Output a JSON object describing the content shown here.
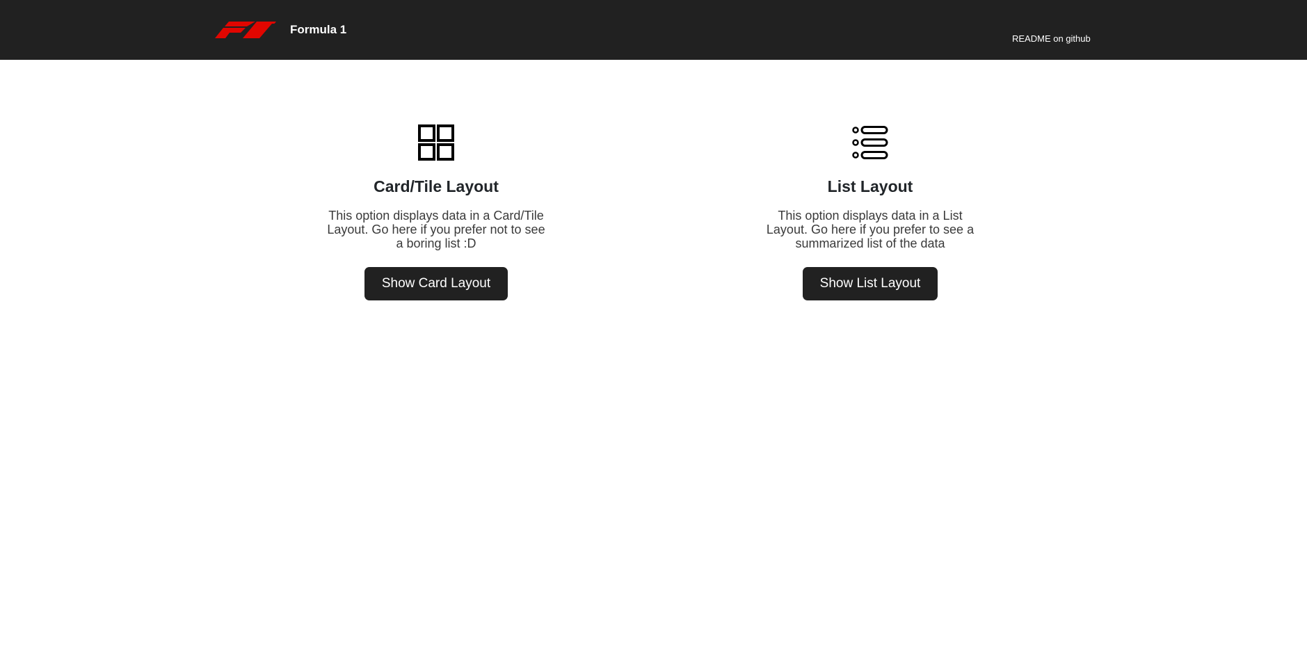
{
  "navbar": {
    "brand_text": "Formula 1",
    "readme_link": "README on github",
    "brand_color": "#e10600",
    "background": "#212121"
  },
  "options": [
    {
      "icon": "grid-icon",
      "title": "Card/Tile Layout",
      "description": "This option displays data in a Card/Tile Layout. Go here if you prefer not to see a boring list :D",
      "button_label": "Show Card Layout"
    },
    {
      "icon": "list-icon",
      "title": "List Layout",
      "description": "This option displays data in a List Layout. Go here if you prefer to see a summarized list of the data",
      "button_label": "Show List Layout"
    }
  ]
}
